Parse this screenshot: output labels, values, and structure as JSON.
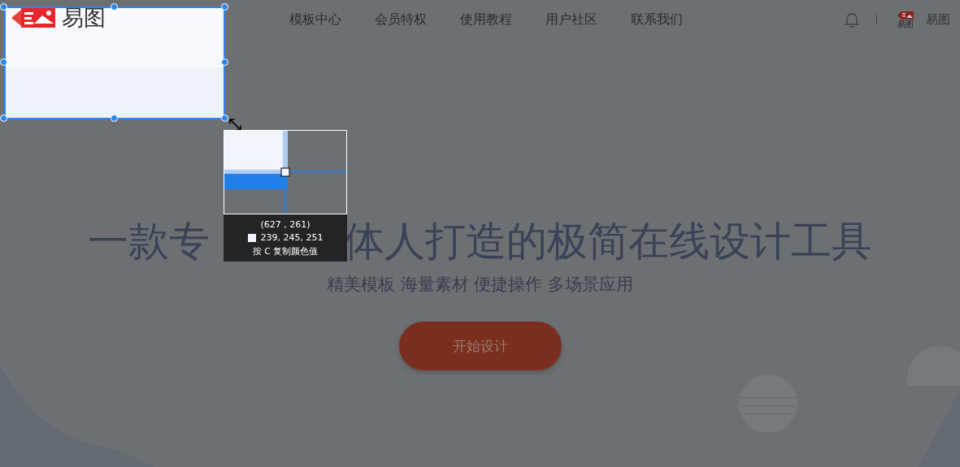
{
  "header": {
    "logo_text": "易图",
    "nav": [
      {
        "label": "模板中心"
      },
      {
        "label": "会员特权"
      },
      {
        "label": "使用教程"
      },
      {
        "label": "用户社区"
      },
      {
        "label": "联系我们"
      }
    ],
    "avatar_caption": "易图",
    "user_name": "易图"
  },
  "hero": {
    "title_parts": [
      "一款专",
      "体人打造的极简在线设计工具"
    ],
    "subtitle": "精美模板 海量素材 便捷操作 多场景应用",
    "button": "开始设计"
  },
  "capture": {
    "coords": "(627 , 261)",
    "color": "#eff5fb",
    "color_value": "239, 245, 251",
    "hint": "按 C 复制颜色值"
  }
}
